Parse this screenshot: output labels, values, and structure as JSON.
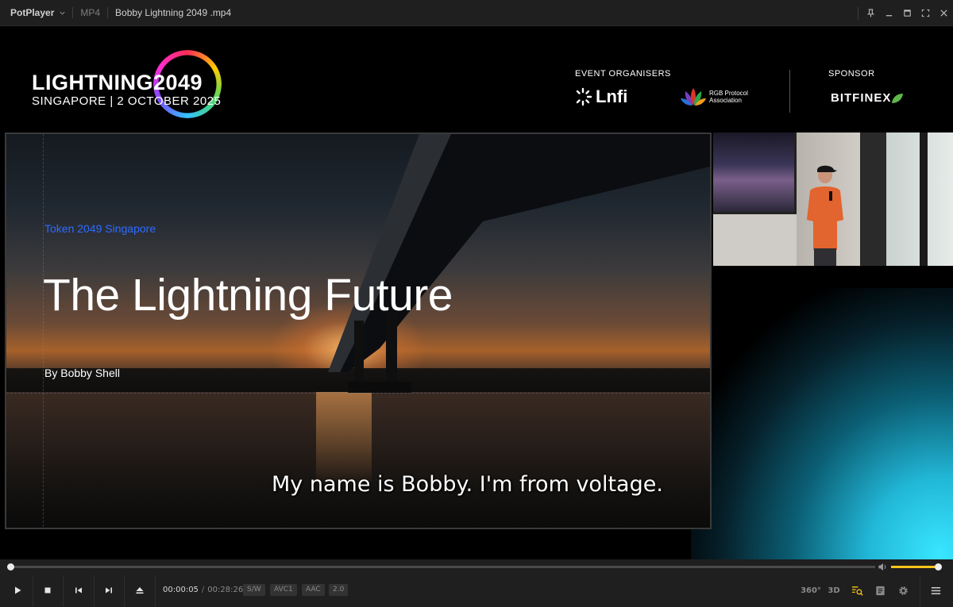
{
  "titlebar": {
    "app_name": "PotPlayer",
    "format": "MP4",
    "file_title": "Bobby Lightning 2049 .mp4",
    "icons": [
      "chevron-down-icon",
      "pin-icon",
      "minimize-icon",
      "maximize-icon",
      "fullscreen-icon",
      "close-icon"
    ]
  },
  "video": {
    "brand": {
      "name": "LIGHTNING2049",
      "subline": "SINGAPORE | 2 OCTOBER 2025"
    },
    "organisers_label": "EVENT ORGANISERS",
    "organiser_1": "Lnfi",
    "organiser_2": "RGB Protocol Association",
    "sponsor_label": "SPONSOR",
    "sponsor": "BITFINEX",
    "slide": {
      "eyebrow": "Token 2049 Singapore",
      "title": "The Lightning Future",
      "author": "By Bobby Shell"
    },
    "subtitle": "My name is Bobby. I'm from voltage."
  },
  "controls": {
    "seek_fraction": 0.003,
    "volume_fraction": 0.95,
    "current_time": "00:00:05",
    "separator": "/",
    "duration": "00:28:26",
    "badges": [
      "S/W",
      "AVC1",
      "AAC",
      "2.0"
    ],
    "right_labels": {
      "vr": "360°",
      "threed": "3D"
    },
    "accent_color": "#f5c518",
    "icons": [
      "play-icon",
      "stop-icon",
      "previous-icon",
      "next-icon",
      "eject-icon",
      "volume-icon",
      "search-zoom-icon",
      "playlist-icon",
      "settings-icon",
      "menu-icon"
    ]
  }
}
